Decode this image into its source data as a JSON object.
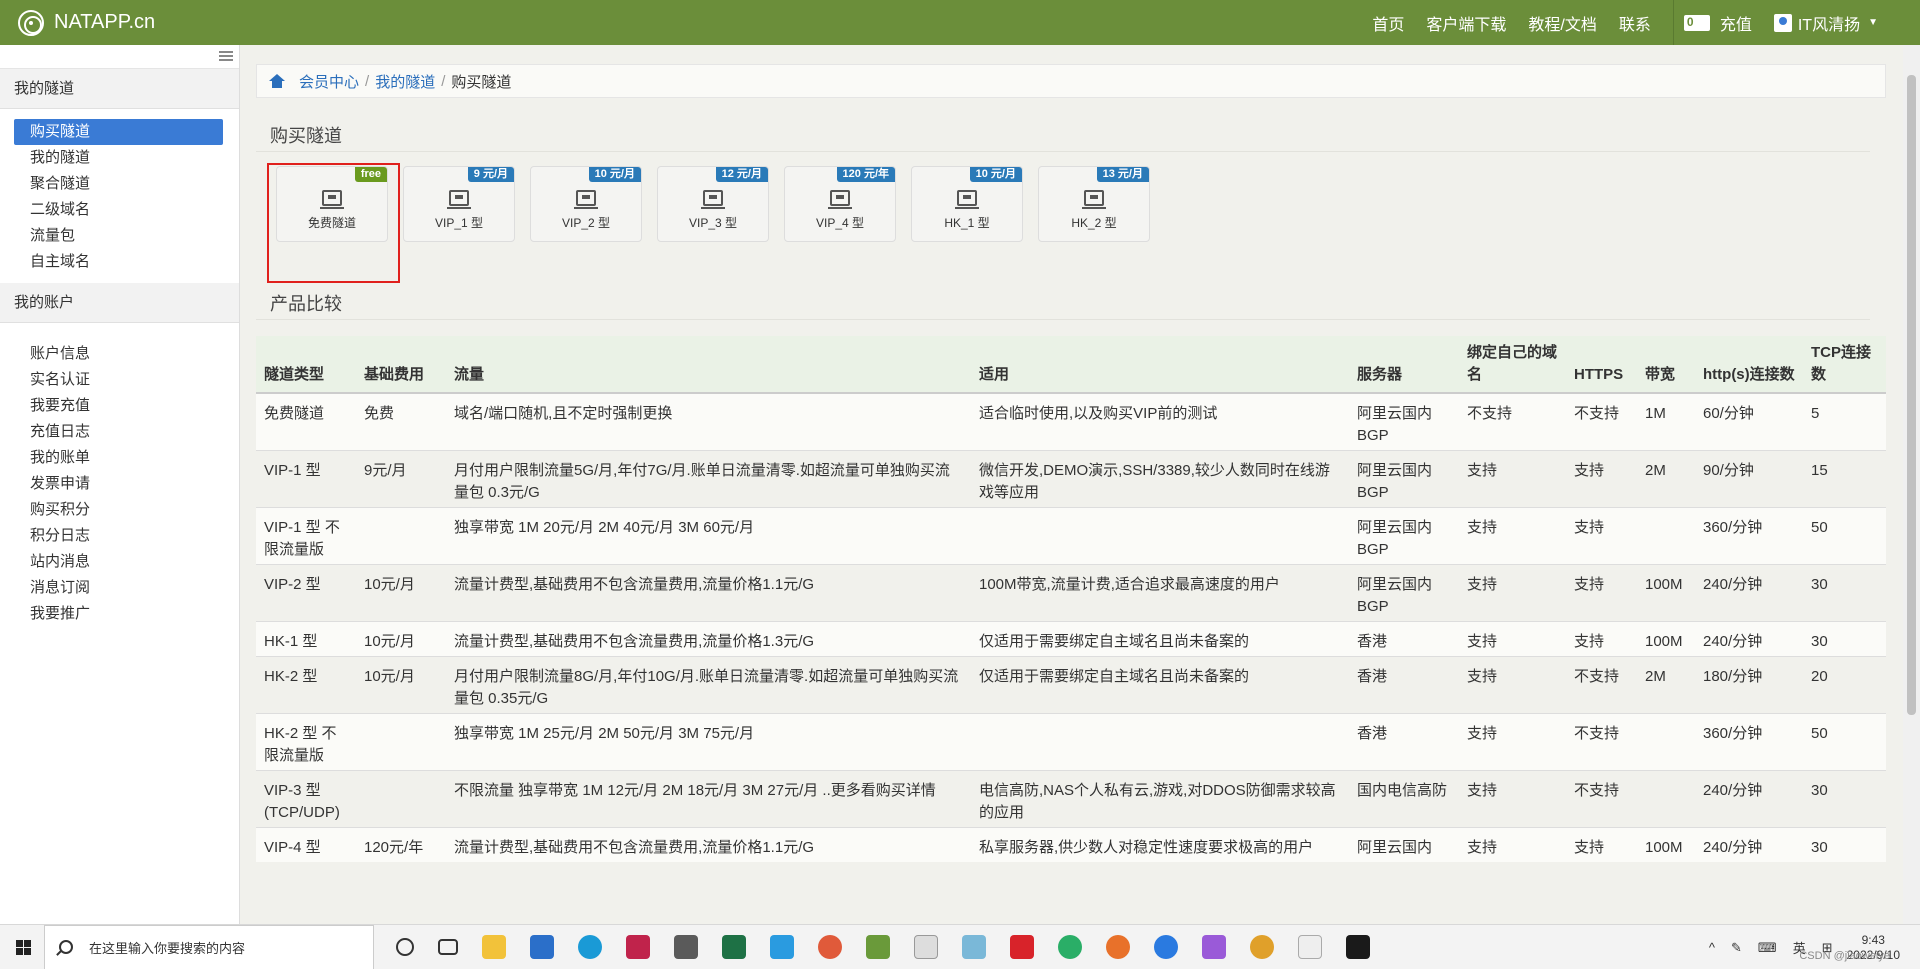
{
  "navbar": {
    "brand": "NATAPP.cn",
    "links": [
      "首页",
      "客户端下载",
      "教程/文档",
      "联系"
    ],
    "recharge": "充值",
    "user": "IT风清扬"
  },
  "sidebar": {
    "group1_title": "我的隧道",
    "group1_items": [
      "购买隧道",
      "我的隧道",
      "聚合隧道",
      "二级域名",
      "流量包",
      "自主域名"
    ],
    "group2_title": "我的账户",
    "group2_items": [
      "账户信息",
      "实名认证",
      "我要充值",
      "充值日志",
      "我的账单",
      "发票申请",
      "购买积分",
      "积分日志",
      "站内消息",
      "消息订阅",
      "我要推广"
    ]
  },
  "breadcrumb": {
    "items": [
      "会员中心",
      "我的隧道"
    ],
    "current": "购买隧道"
  },
  "section_buy": {
    "title": "购买隧道"
  },
  "tunnel_cards": [
    {
      "label": "免费隧道",
      "badge": "free"
    },
    {
      "label": "VIP_1 型",
      "badge": "9 元/月"
    },
    {
      "label": "VIP_2 型",
      "badge": "10 元/月"
    },
    {
      "label": "VIP_3 型",
      "badge": "12 元/月"
    },
    {
      "label": "VIP_4 型",
      "badge": "120 元/年"
    },
    {
      "label": "HK_1 型",
      "badge": "10 元/月"
    },
    {
      "label": "HK_2 型",
      "badge": "13 元/月"
    }
  ],
  "section_compare": {
    "title": "产品比较"
  },
  "table": {
    "headers": [
      "隧道类型",
      "基础费用",
      "流量",
      "适用",
      "服务器",
      "绑定自己的域名",
      "HTTPS",
      "带宽",
      "http(s)连接数",
      "TCP连接数"
    ],
    "rows": [
      [
        "免费隧道",
        "免费",
        "域名/端口随机,且不定时强制更换",
        "适合临时使用,以及购买VIP前的测试",
        "阿里云国内BGP",
        "不支持",
        "不支持",
        "1M",
        "60/分钟",
        "5"
      ],
      [
        "VIP-1 型",
        "9元/月",
        "月付用户限制流量5G/月,年付7G/月.账单日流量清零.如超流量可单独购买流量包 0.3元/G",
        "微信开发,DEMO演示,SSH/3389,较少人数同时在线游戏等应用",
        "阿里云国内BGP",
        "支持",
        "支持",
        "2M",
        "90/分钟",
        "15"
      ],
      [
        "VIP-1 型 不限流量版",
        "",
        "独享带宽 1M 20元/月 2M 40元/月 3M 60元/月",
        "",
        "阿里云国内BGP",
        "支持",
        "支持",
        "",
        "360/分钟",
        "50"
      ],
      [
        "VIP-2 型",
        "10元/月",
        "流量计费型,基础费用不包含流量费用,流量价格1.1元/G",
        "100M带宽,流量计费,适合追求最高速度的用户",
        "阿里云国内BGP",
        "支持",
        "支持",
        "100M",
        "240/分钟",
        "30"
      ],
      [
        "HK-1 型",
        "10元/月",
        "流量计费型,基础费用不包含流量费用,流量价格1.3元/G",
        "仅适用于需要绑定自主域名且尚未备案的",
        "香港",
        "支持",
        "支持",
        "100M",
        "240/分钟",
        "30"
      ],
      [
        "HK-2 型",
        "10元/月",
        "月付用户限制流量8G/月,年付10G/月.账单日流量清零.如超流量可单独购买流量包 0.35元/G",
        "仅适用于需要绑定自主域名且尚未备案的",
        "香港",
        "支持",
        "不支持",
        "2M",
        "180/分钟",
        "20"
      ],
      [
        "HK-2 型 不限流量版",
        "",
        "独享带宽 1M 25元/月 2M 50元/月 3M 75元/月",
        "",
        "香港",
        "支持",
        "不支持",
        "",
        "360/分钟",
        "50"
      ],
      [
        "VIP-3 型 (TCP/UDP)",
        "",
        "不限流量 独享带宽 1M 12元/月 2M 18元/月 3M 27元/月 ..更多看购买详情",
        "电信高防,NAS个人私有云,游戏,对DDOS防御需求较高的应用",
        "国内电信高防",
        "支持",
        "不支持",
        "",
        "240/分钟",
        "30"
      ],
      [
        "VIP-4 型",
        "120元/年",
        "流量计费型,基础费用不包含流量费用,流量价格1.1元/G",
        "私享服务器,供少数人对稳定性速度要求极高的用户",
        "阿里云国内",
        "支持",
        "支持",
        "100M",
        "240/分钟",
        "30"
      ]
    ]
  },
  "taskbar": {
    "search_placeholder": "在这里输入你要搜索的内容",
    "tray_lang": "英",
    "time": "9:43",
    "date": "2022/9/10",
    "watermark": "CSDN @jiaoweiye"
  }
}
